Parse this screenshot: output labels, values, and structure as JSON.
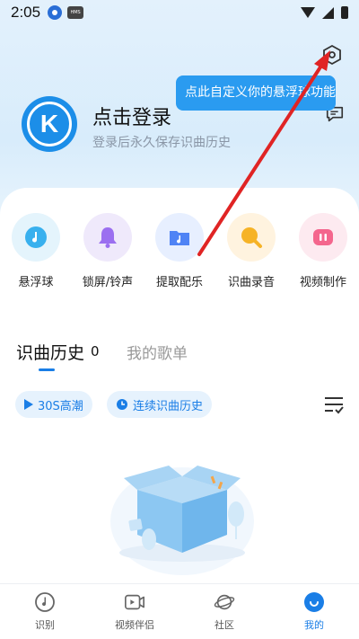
{
  "status_bar": {
    "time": "2:05",
    "badge_text": "HMS"
  },
  "tooltip": {
    "text": "点此自定义你的悬浮球功能"
  },
  "profile": {
    "avatar_letter": "K",
    "title": "点击登录",
    "subtitle": "登录后永久保存识曲历史"
  },
  "shortcuts": [
    {
      "label": "悬浮球",
      "icon": "music-note-icon",
      "bg": "#e4f4fc",
      "color": "#38b0ee"
    },
    {
      "label": "锁屏/铃声",
      "icon": "bell-icon",
      "bg": "#efe9fb",
      "color": "#9b6ff0"
    },
    {
      "label": "提取配乐",
      "icon": "folder-music-icon",
      "bg": "#e7efff",
      "color": "#4f83f5"
    },
    {
      "label": "识曲录音",
      "icon": "record-icon",
      "bg": "#fff3df",
      "color": "#f6b326"
    },
    {
      "label": "视频制作",
      "icon": "video-icon",
      "bg": "#fdeaf0",
      "color": "#f4668d"
    }
  ],
  "tabs": {
    "history_label": "识曲历史",
    "history_count": "0",
    "playlist_label": "我的歌单"
  },
  "chips": {
    "peak_label": "30S高潮",
    "continuous_label": "连续识曲历史"
  },
  "bottom_nav": [
    {
      "label": "识别",
      "icon": "music-note-circle-icon",
      "active": false
    },
    {
      "label": "视频伴侣",
      "icon": "video-play-icon",
      "active": false
    },
    {
      "label": "社区",
      "icon": "planet-icon",
      "active": false
    },
    {
      "label": "我的",
      "icon": "profile-icon",
      "active": true
    }
  ],
  "colors": {
    "accent": "#1a7ee6",
    "tooltip": "#2a9bf0",
    "arrow": "#e02424"
  }
}
